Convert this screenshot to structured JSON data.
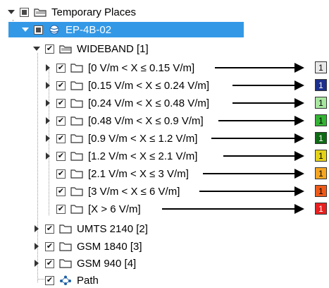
{
  "tree": {
    "root": {
      "label": "Temporary Places"
    },
    "selected": {
      "label": "EP-4B-02"
    },
    "wideband": {
      "label": "WIDEBAND [1]"
    },
    "ranges": [
      {
        "label": "[0 V/m < X ≤ 0.15 V/m]",
        "badge": "1",
        "badge_color": "#e8e8e8",
        "badge_text_color": "#000000",
        "expandable": true
      },
      {
        "label": "[0.15 V/m < X ≤ 0.24 V/m]",
        "badge": "1",
        "badge_color": "#1c2f8c",
        "badge_text_color": "#ffffff",
        "expandable": true
      },
      {
        "label": "[0.24 V/m < X ≤ 0.48 V/m]",
        "badge": "1",
        "badge_color": "#a8e6a0",
        "badge_text_color": "#000000",
        "expandable": true
      },
      {
        "label": "[0.48 V/m < X ≤ 0.9 V/m]",
        "badge": "1",
        "badge_color": "#34b334",
        "badge_text_color": "#000000",
        "expandable": true
      },
      {
        "label": "[0.9 V/m < X ≤ 1.2 V/m]",
        "badge": "1",
        "badge_color": "#0e6a14",
        "badge_text_color": "#ffffff",
        "expandable": true
      },
      {
        "label": "[1.2 V/m < X ≤ 2.1 V/m]",
        "badge": "1",
        "badge_color": "#e3d21a",
        "badge_text_color": "#000000",
        "expandable": true
      },
      {
        "label": "[2.1 V/m < X ≤ 3 V/m]",
        "badge": "1",
        "badge_color": "#f5a623",
        "badge_text_color": "#000000",
        "expandable": false
      },
      {
        "label": "[3 V/m < X ≤ 6 V/m]",
        "badge": "1",
        "badge_color": "#ee5a1a",
        "badge_text_color": "#000000",
        "expandable": false
      },
      {
        "label": "[X > 6 V/m]",
        "badge": "1",
        "badge_color": "#e82020",
        "badge_text_color": "#ffffff",
        "expandable": false
      }
    ],
    "siblings": [
      {
        "label": "UMTS 2140 [2]"
      },
      {
        "label": "GSM 1840 [3]"
      },
      {
        "label": "GSM 940 [4]"
      }
    ],
    "path": {
      "label": "Path"
    }
  },
  "colors": {
    "selection": "#3399e6"
  }
}
